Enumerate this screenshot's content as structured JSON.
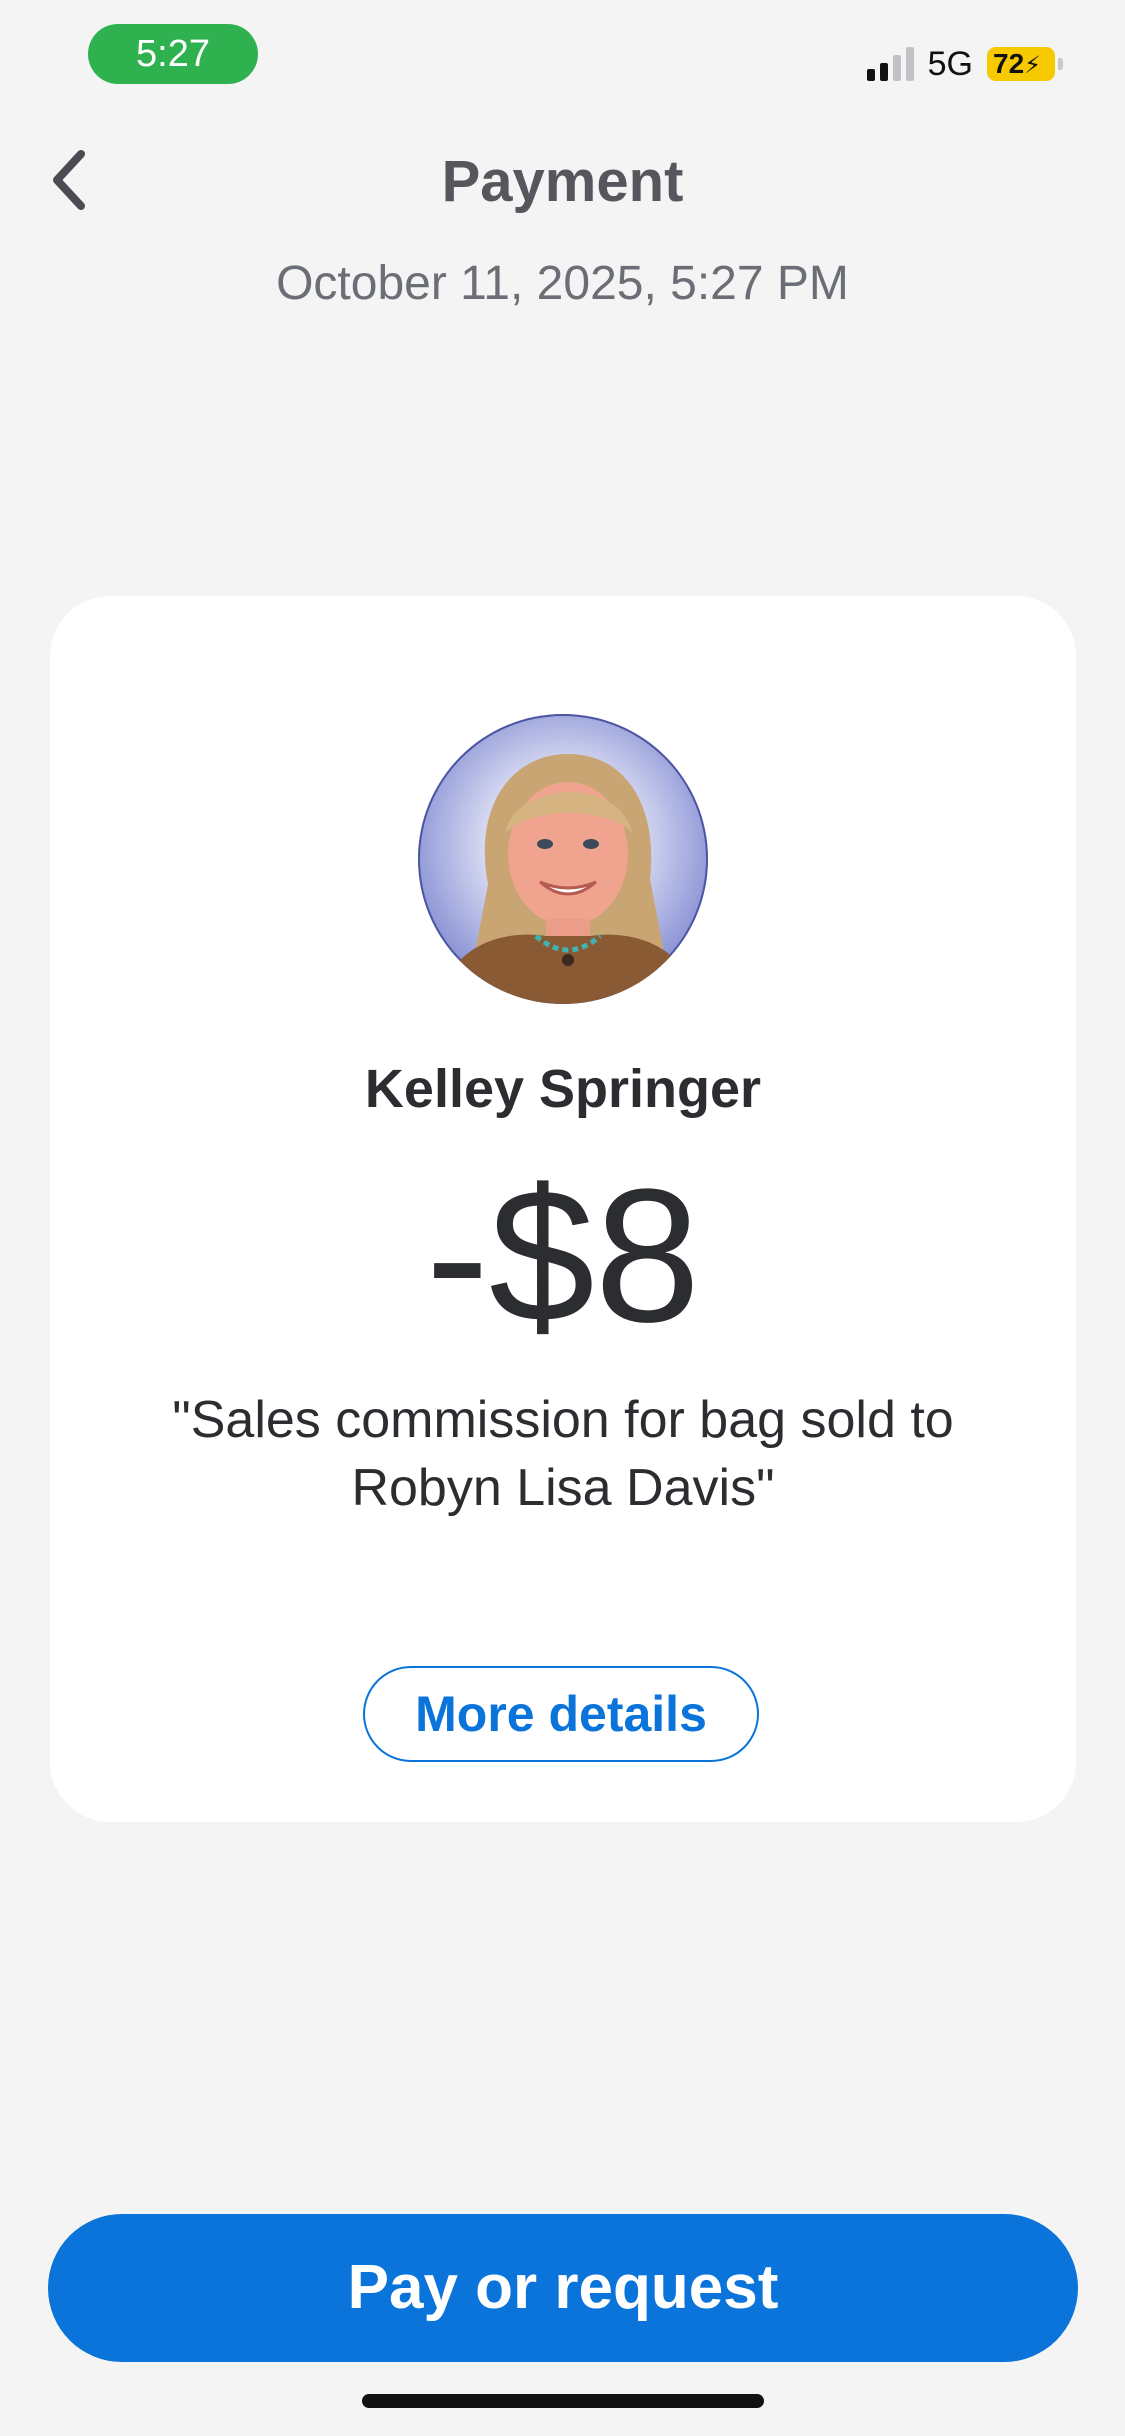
{
  "status_bar": {
    "time": "5:27",
    "network": "5G",
    "battery": "72",
    "colors": {
      "time_pill": "#30b150",
      "battery": "#f7c900"
    }
  },
  "header": {
    "back_icon": "chevron-left-icon",
    "title": "Payment",
    "timestamp": "October 11, 2025, 5:27 PM"
  },
  "transaction": {
    "avatar": "avatar-photo",
    "name": "Kelley Springer",
    "amount": "-$8",
    "note_line1": "\"Sales commission for bag sold to",
    "note_line2": "Robyn Lisa Davis\"",
    "details_label": "More details"
  },
  "footer": {
    "primary_label": "Pay or request"
  },
  "theme": {
    "accent": "#0a74da",
    "background": "#f4f4f5",
    "card": "#ffffff",
    "text": "#2b2d31"
  }
}
